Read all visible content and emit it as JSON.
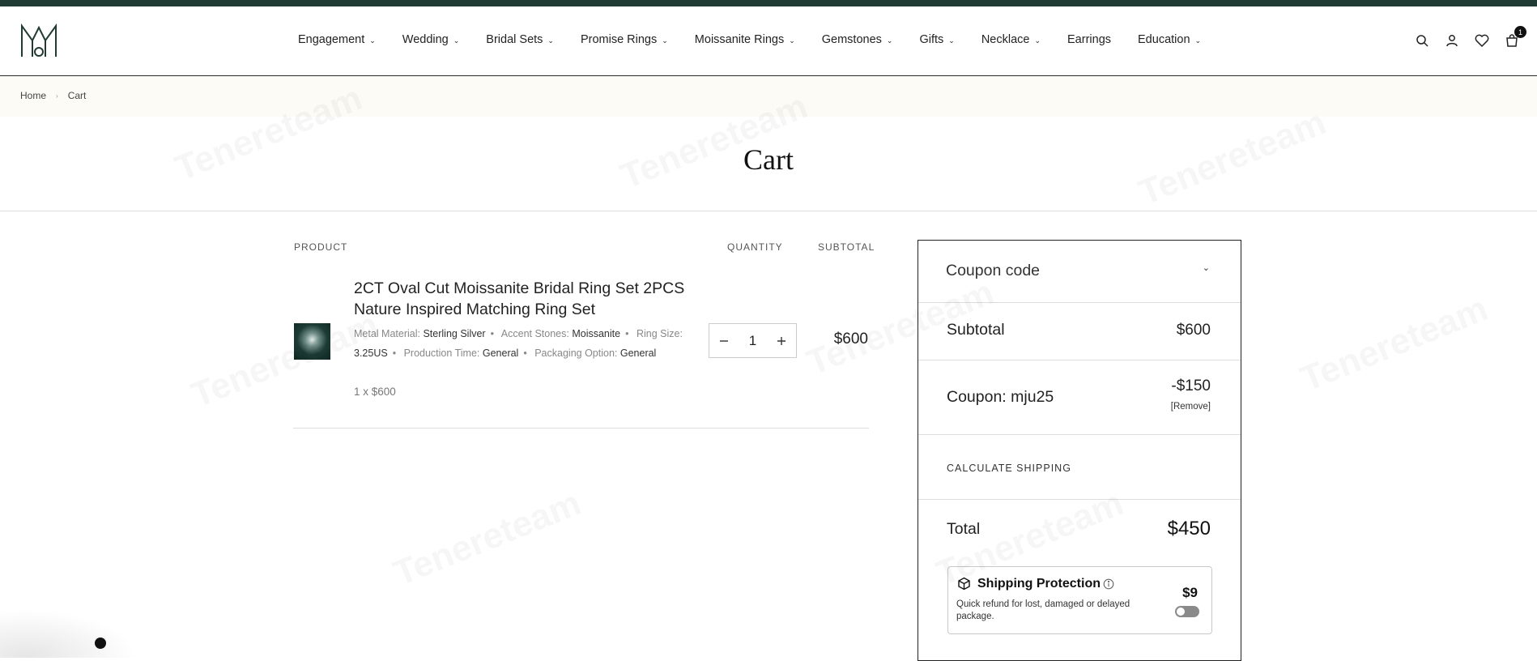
{
  "brand": {
    "accent_color": "#1f3b33"
  },
  "nav": {
    "items": [
      {
        "label": "Engagement",
        "dropdown": true
      },
      {
        "label": "Wedding",
        "dropdown": true
      },
      {
        "label": "Bridal Sets",
        "dropdown": true
      },
      {
        "label": "Promise Rings",
        "dropdown": true
      },
      {
        "label": "Moissanite Rings",
        "dropdown": true
      },
      {
        "label": "Gemstones",
        "dropdown": true
      },
      {
        "label": "Gifts",
        "dropdown": true
      },
      {
        "label": "Necklace",
        "dropdown": true
      },
      {
        "label": "Earrings",
        "dropdown": false
      },
      {
        "label": "Education",
        "dropdown": true
      }
    ],
    "icons": [
      "search-icon",
      "account-icon",
      "heart-icon",
      "cart-icon"
    ],
    "cart_count": "1"
  },
  "breadcrumb": {
    "home": "Home",
    "current": "Cart"
  },
  "page": {
    "title": "Cart"
  },
  "table": {
    "product_header": "PRODUCT",
    "quantity_header": "QUANTITY",
    "subtotal_header": "SUBTOTAL"
  },
  "item": {
    "title": "2CT Oval Cut Moissanite Bridal Ring Set 2PCS Nature Inspired Matching Ring Set",
    "metal_label": "Metal Material:",
    "metal_value": "Sterling Silver",
    "accent_label": "Accent Stones:",
    "accent_value": "Moissanite",
    "ring_size_label": "Ring Size:",
    "ring_size_value": "3.25US",
    "production_label": "Production Time:",
    "production_value": "General",
    "packaging_label": "Packaging Option:",
    "packaging_value": "General",
    "unit_line": "1 x $600",
    "quantity": "1",
    "subtotal": "$600"
  },
  "summary": {
    "coupon_code_label": "Coupon code",
    "subtotal_label": "Subtotal",
    "subtotal_value": "$600",
    "coupon_label": "Coupon: mju25",
    "coupon_discount": "-$150",
    "remove_label": "[Remove]",
    "calculate_shipping": "CALCULATE SHIPPING",
    "total_label": "Total",
    "total_value": "$450"
  },
  "protection": {
    "title": "Shipping Protection",
    "description": "Quick refund for lost, damaged or delayed package.",
    "price": "$9",
    "enabled": false
  },
  "watermark": {
    "text": "Tenereteam"
  }
}
